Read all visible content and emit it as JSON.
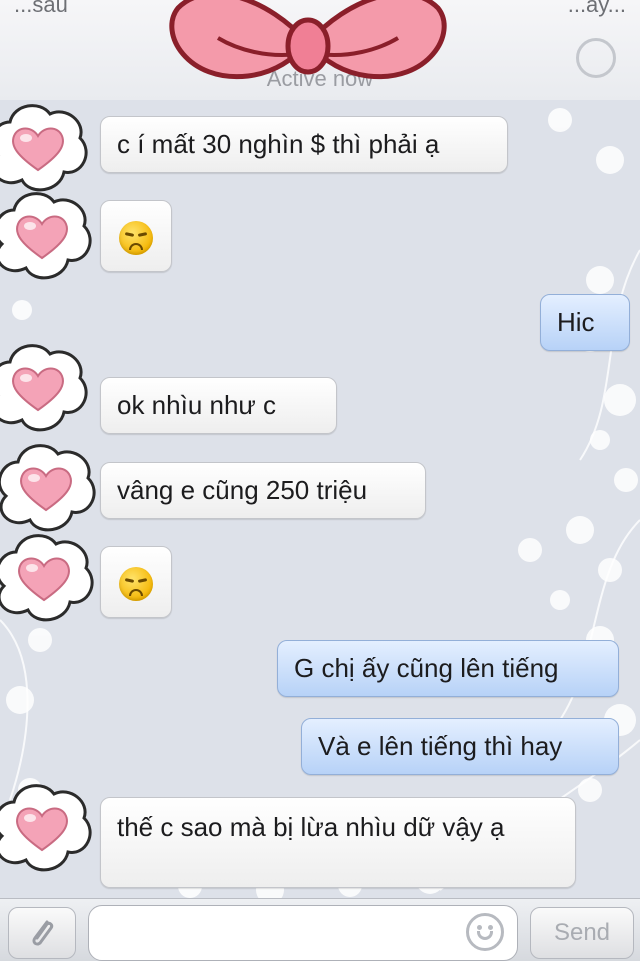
{
  "header": {
    "left_text": "...sau",
    "right_text": "...ay...",
    "status_text": "Active now"
  },
  "messages": [
    {
      "sender": "other",
      "text": "c í mất 30 nghìn $ thì phải ạ"
    },
    {
      "sender": "other",
      "emoji": "disappointed-face"
    },
    {
      "sender": "me",
      "text": "Hic"
    },
    {
      "sender": "other",
      "text": "ok nhìu như c"
    },
    {
      "sender": "other",
      "text": "vâng e cũng 250 triệu"
    },
    {
      "sender": "other",
      "emoji": "disappointed-face"
    },
    {
      "sender": "me",
      "text": "G chị ấy cũng lên tiếng"
    },
    {
      "sender": "me",
      "text": "Và e lên tiếng thì hay"
    },
    {
      "sender": "other",
      "text": "thế c sao mà bị lừa nhìu dữ vậy ạ"
    }
  ],
  "input": {
    "value": "",
    "placeholder": ""
  },
  "send_label": "Send",
  "colors": {
    "incoming_bubble": "#ffffff",
    "outgoing_bubble": "#c7dcfa",
    "chat_background": "#dde1e9",
    "heart": "#f4a3b7",
    "bow": "#f49aaa"
  },
  "icons": {
    "avatar": "heart-cloud-icon",
    "emoji": "disappointed-face-icon",
    "attach": "paperclip-icon",
    "smiley": "smiley-icon",
    "help": "help-icon"
  }
}
